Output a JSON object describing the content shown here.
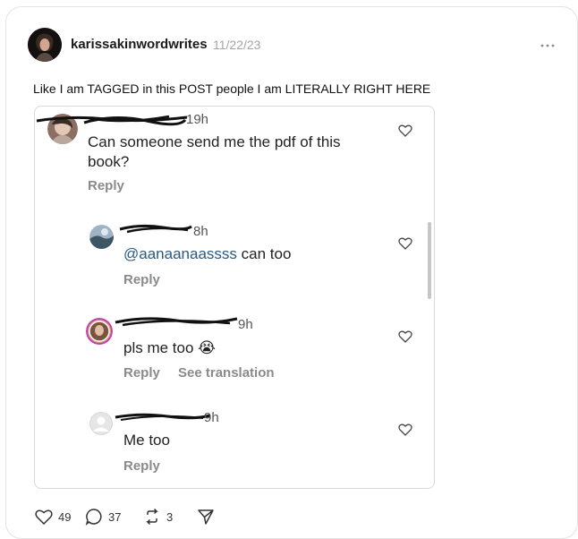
{
  "post": {
    "author": "karissakinwordwrites",
    "date": "11/22/23",
    "text": "Like I am TAGGED in this POST people I am LITERALLY RIGHT HERE"
  },
  "comments": [
    {
      "username_suffix": "19h",
      "text": "Can someone send me the pdf of this book?",
      "reply": "Reply"
    },
    {
      "username_suffix": "8h",
      "mention": "@aanaanaassss",
      "text": " can too",
      "reply": "Reply"
    },
    {
      "username_suffix": "9h",
      "text": "pls me too 😭",
      "reply": "Reply",
      "translate": "See translation"
    },
    {
      "username_suffix": "9h",
      "text": "Me too",
      "reply": "Reply"
    }
  ],
  "actions": {
    "likes": "49",
    "comments": "37",
    "reposts": "3"
  },
  "icons": [
    "more-icon",
    "heart-icon",
    "comment-icon",
    "repost-icon",
    "share-icon"
  ]
}
